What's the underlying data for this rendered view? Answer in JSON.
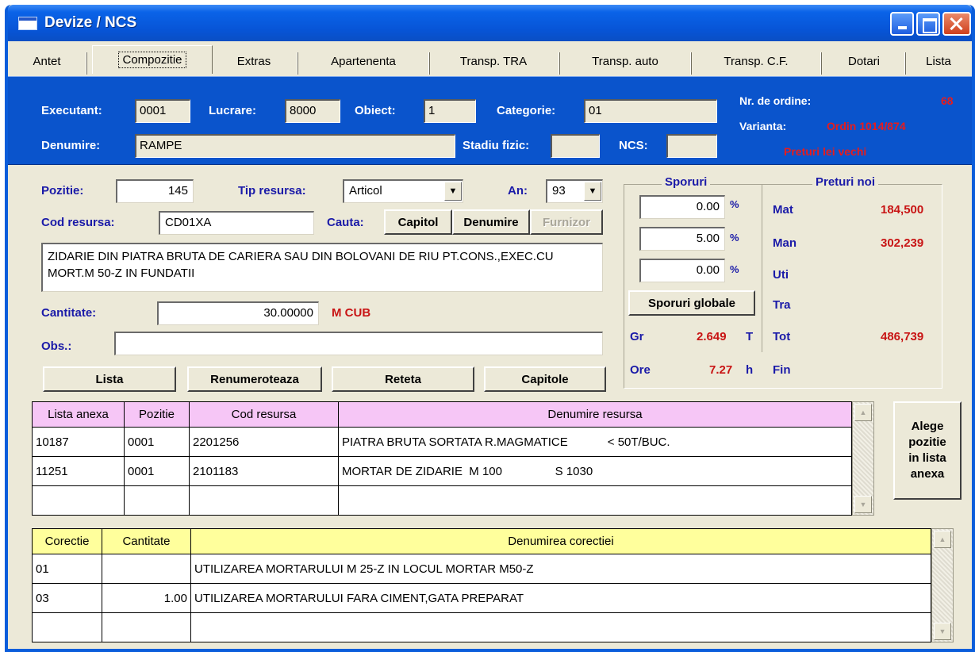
{
  "window": {
    "title": "Devize / NCS"
  },
  "tabs": [
    "Antet",
    "Compozitie",
    "Extras",
    "Apartenenta",
    "Transp. TRA",
    "Transp. auto",
    "Transp. C.F.",
    "Dotari",
    "Lista"
  ],
  "header": {
    "executant_label": "Executant:",
    "executant": "0001",
    "lucrare_label": "Lucrare:",
    "lucrare": "8000",
    "obiect_label": "Obiect:",
    "obiect": "1",
    "categorie_label": "Categorie:",
    "categorie": "01",
    "denumire_label": "Denumire:",
    "denumire": "RAMPE",
    "stadiu_label": "Stadiu fizic:",
    "stadiu": "",
    "ncs_label": "NCS:",
    "ncs": "",
    "nr_ordine_label": "Nr. de ordine:",
    "nr_ordine": "68",
    "varianta_label": "Varianta:",
    "varianta": "Ordin 1014/874",
    "preturi_note": "Preturi lei vechi"
  },
  "form": {
    "pozitie_label": "Pozitie:",
    "pozitie": "145",
    "tip_label": "Tip resursa:",
    "tip": "Articol",
    "an_label": "An:",
    "an": "93",
    "cod_label": "Cod resursa:",
    "cod": "CD01XA",
    "cauta_label": "Cauta:",
    "description": "ZIDARIE DIN PIATRA BRUTA DE CARIERA SAU DIN BOLOVANI DE RIU PT.CONS.,EXEC.CU MORT.M 50-Z IN FUNDATII",
    "cantitate_label": "Cantitate:",
    "cantitate": "30.00000",
    "unit": "M CUB",
    "obs_label": "Obs.:",
    "obs": ""
  },
  "buttons": {
    "capitol": "Capitol",
    "denumire": "Denumire",
    "furnizor": "Furnizor",
    "lista": "Lista",
    "renumeroteaza": "Renumeroteaza",
    "reteta": "Reteta",
    "capitole": "Capitole",
    "sporuri_globale": "Sporuri globale",
    "alege": [
      "Alege",
      "pozitie",
      "in lista",
      "anexa"
    ]
  },
  "sporuri": {
    "title": "Sporuri",
    "values": [
      "0.00",
      "5.00",
      "0.00"
    ],
    "pct": "%",
    "gr_label": "Gr",
    "gr": "2.649",
    "gr_unit": "T",
    "ore_label": "Ore",
    "ore": "7.27",
    "ore_unit": "h"
  },
  "preturi": {
    "title": "Preturi noi",
    "rows": [
      {
        "label": "Mat",
        "value": "184,500"
      },
      {
        "label": "Man",
        "value": "302,239"
      },
      {
        "label": "Uti",
        "value": ""
      },
      {
        "label": "Tra",
        "value": ""
      },
      {
        "label": "Tot",
        "value": "486,739"
      },
      {
        "label": "Fin",
        "value": ""
      }
    ]
  },
  "anexa_table": {
    "headers": [
      "Lista anexa",
      "Pozitie",
      "Cod resursa",
      "Denumire resursa"
    ],
    "rows": [
      [
        "10187",
        "0001",
        "2201256",
        "PIATRA BRUTA SORTATA R.MAGMATICE            < 50T/BUC."
      ],
      [
        "11251",
        "0001",
        "2101183",
        "MORTAR DE ZIDARIE  M 100                S 1030"
      ],
      [
        "",
        "",
        "",
        ""
      ]
    ]
  },
  "corectii_table": {
    "headers": [
      "Corectie",
      "Cantitate",
      "Denumirea corectiei"
    ],
    "rows": [
      [
        "01",
        "",
        "UTILIZAREA MORTARULUI M 25-Z IN LOCUL MORTAR M50-Z"
      ],
      [
        "03",
        "1.00",
        "UTILIZAREA MORTARULUI FARA CIMENT,GATA PREPARAT"
      ],
      [
        "",
        "",
        ""
      ]
    ]
  }
}
